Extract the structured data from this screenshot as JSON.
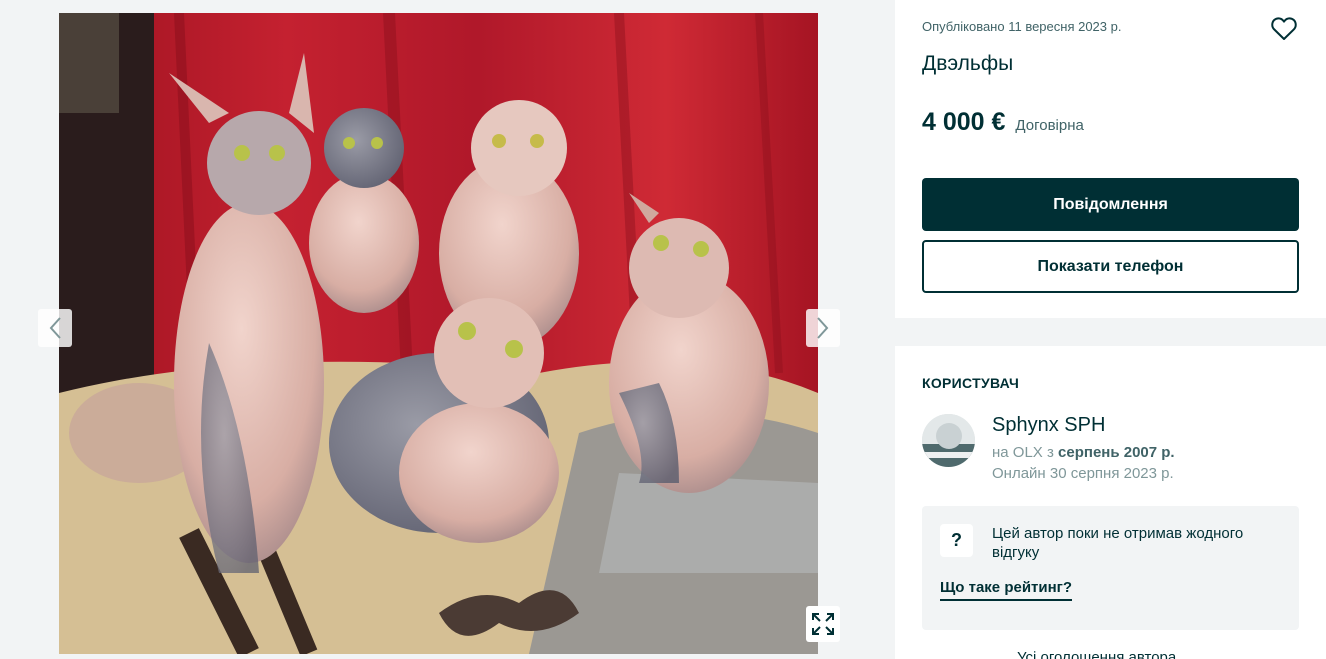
{
  "gallery": {
    "prev_icon": "chevron-left-icon",
    "next_icon": "chevron-right-icon",
    "fullscreen_icon": "expand-icon"
  },
  "offer": {
    "published": "Опубліковано 11 вересня 2023 р.",
    "title": "Двэльфы",
    "price": "4 000 €",
    "negotiable": "Договірна",
    "message_button": "Повідомлення",
    "phone_button": "Показати телефон",
    "favorite_icon": "heart-icon"
  },
  "user": {
    "section_title": "КОРИСТУВАЧ",
    "name": "Sphynx SPH",
    "since_prefix": "на OLX з",
    "since_date": "серпень 2007 р.",
    "online": "Онлайн 30 серпня 2023 р.",
    "rating_icon": "?",
    "rating_text": "Цей автор поки не отримав жодного відгуку",
    "rating_link": "Що таке рейтинг?",
    "cut_off_text": "Усі оголошення автора"
  },
  "colors": {
    "primary": "#002f34",
    "secondary_text": "#406367",
    "muted_text": "#7f9799",
    "page_background": "#f2f4f5"
  }
}
